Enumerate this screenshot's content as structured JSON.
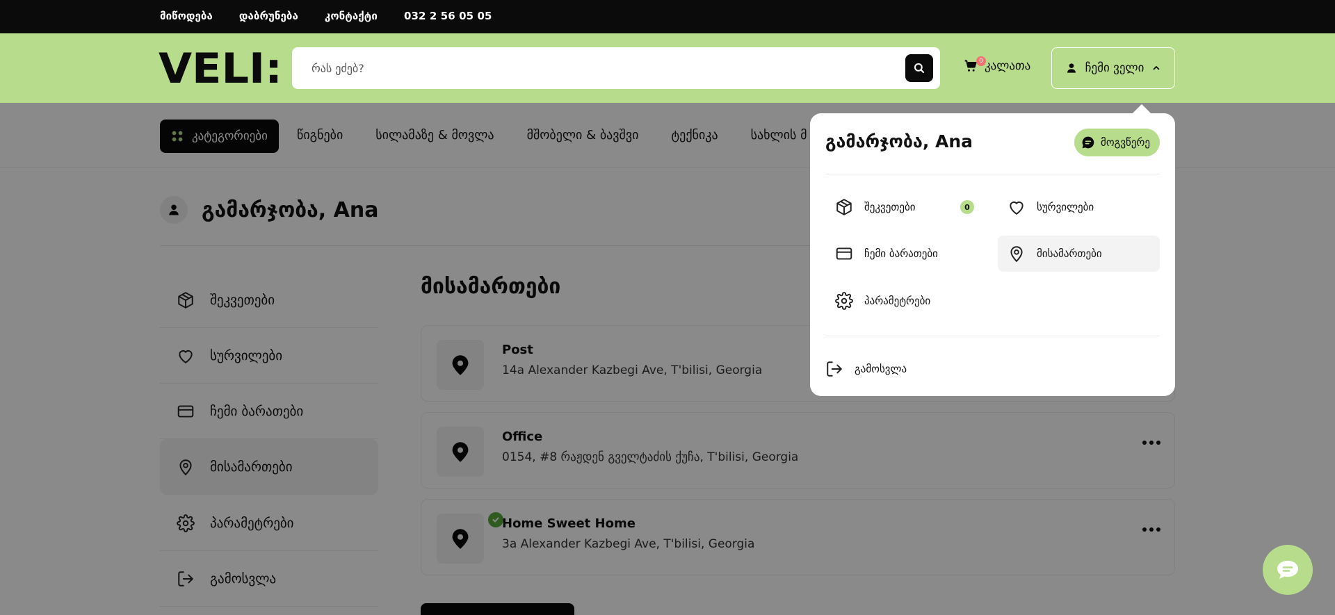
{
  "topbar": {
    "links": [
      "მიწოდება",
      "დაბრუნება",
      "კონტაქტი"
    ],
    "phone": "032 2 56 05 05"
  },
  "header": {
    "logo_text": "VELI:",
    "search": {
      "placeholder": "რას ეძებ?",
      "value": ""
    },
    "cart": {
      "count": "0",
      "label": "კალათა"
    },
    "account_label": "ჩემი ველი"
  },
  "categories": {
    "all_label": "კატეგორიები",
    "items": [
      "წიგნები",
      "სილამაზე & მოვლა",
      "მშობელი & ბავშვი",
      "ტექნიკა",
      "სახლის მ"
    ]
  },
  "account": {
    "greeting": "გამარჯობა, Ana",
    "menu": [
      {
        "label": "შეკვეთები",
        "icon": "box-icon"
      },
      {
        "label": "სურვილები",
        "icon": "heart-icon"
      },
      {
        "label": "ჩემი ბარათები",
        "icon": "card-icon"
      },
      {
        "label": "მისამართები",
        "icon": "pin-icon",
        "active": true
      },
      {
        "label": "პარამეტრები",
        "icon": "gear-icon"
      },
      {
        "label": "გამოსვლა",
        "icon": "logout-icon"
      }
    ],
    "section_title": "მისამართები",
    "addresses": [
      {
        "name": "Post",
        "line": "14a Alexander Kazbegi Ave, T'bilisi, Georgia",
        "default": false
      },
      {
        "name": "Office",
        "line": "0154, #8 რაჟდენ გველტაძის ქუჩა, T'bilisi, Georgia",
        "default": false
      },
      {
        "name": "Home Sweet Home",
        "line": "3a Alexander Kazbegi Ave, T'bilisi, Georgia",
        "default": true
      }
    ]
  },
  "dropdown": {
    "greeting": "გამარჯობა, Ana",
    "write_label": "მოგვწერე",
    "orders_label": "შეკვეთები",
    "orders_count": "0",
    "wishlist_label": "სურვილები",
    "cards_label": "ჩემი ბარათები",
    "addresses_label": "მისამართები",
    "settings_label": "პარამეტრები",
    "logout_label": "გამოსვლა"
  },
  "colors": {
    "accent": "#b7dc8c",
    "dark": "#0b0b0b",
    "badge_red": "#f07272",
    "check_green": "#58a93d"
  }
}
